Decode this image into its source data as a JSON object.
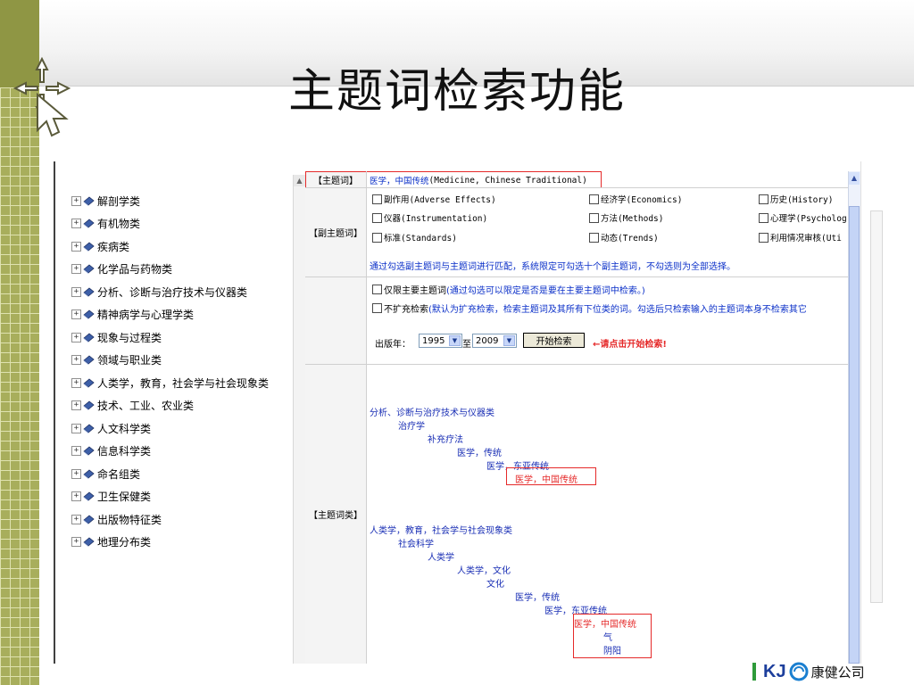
{
  "slide": {
    "title": "主题词检索功能"
  },
  "logo": {
    "mark": "KJ",
    "name": "康健公司"
  },
  "tree": {
    "items": [
      {
        "label": "解剖学类"
      },
      {
        "label": "有机物类"
      },
      {
        "label": "疾病类"
      },
      {
        "label": "化学品与药物类"
      },
      {
        "label": "分析、诊断与治疗技术与仪器类"
      },
      {
        "label": "精神病学与心理学类"
      },
      {
        "label": "现象与过程类"
      },
      {
        "label": "领域与职业类"
      },
      {
        "label": "人类学，教育，社会学与社会现象类"
      },
      {
        "label": "技术、工业、农业类"
      },
      {
        "label": "人文科学类"
      },
      {
        "label": "信息科学类"
      },
      {
        "label": "命名组类"
      },
      {
        "label": "卫生保健类"
      },
      {
        "label": "出版物特征类"
      },
      {
        "label": "地理分布类"
      }
    ]
  },
  "form": {
    "subject_label": "【主题词】",
    "subject_value": "医学，中国传统",
    "subject_value_en": "(Medicine, Chinese Traditional)",
    "sub_label": "【副主题词】",
    "sub_items": [
      {
        "label": "副作用(Adverse Effects)"
      },
      {
        "label": "经济学(Economics)"
      },
      {
        "label": "历史(History)"
      },
      {
        "label": "仪器(Instrumentation)"
      },
      {
        "label": "方法(Methods)"
      },
      {
        "label": "心理学(Psycholog"
      },
      {
        "label": "标准(Standards)"
      },
      {
        "label": "动态(Trends)"
      },
      {
        "label": "利用情况审核(Uti"
      }
    ],
    "sub_hint": "通过勾选副主题词与主题词进行匹配，系统限定可勾选十个副主题词，不勾选则为全部选择。",
    "major_only_label": "仅限主要主题词",
    "major_only_hint": "(通过勾选可以限定是否是要在主要主题词中检索。)",
    "no_expand_label": "不扩充检索",
    "no_expand_hint": "(默认为扩充检索，检索主题词及其所有下位类的词。勾选后只检索输入的主题词本身不检索其它",
    "year_label": "出版年：",
    "year_from": "1995",
    "year_to_sep": "至",
    "year_to": "2009",
    "search_button": "开始检索",
    "search_hint": "←请点击开始检索!",
    "category_label": "【主题词类】"
  },
  "hierarchy_1": [
    {
      "text": "分析、诊断与治疗技术与仪器类"
    },
    {
      "text": "治疗学"
    },
    {
      "text": "补充疗法"
    },
    {
      "text": "医学，传统"
    },
    {
      "text": "医学，东亚传统"
    },
    {
      "text": "医学，中国传统"
    }
  ],
  "hierarchy_2": [
    {
      "text": "人类学，教育，社会学与社会现象类"
    },
    {
      "text": "社会科学"
    },
    {
      "text": "人类学"
    },
    {
      "text": "人类学，文化"
    },
    {
      "text": "文化"
    },
    {
      "text": "医学，传统"
    },
    {
      "text": "医学，东亚传统"
    },
    {
      "text": "医学，中国传统"
    },
    {
      "text": "气"
    },
    {
      "text": "阴阳"
    }
  ],
  "colors": {
    "link_blue": "#1a2fb5",
    "highlight_red": "#e52a2a",
    "accent_olive": "#8f9644"
  }
}
